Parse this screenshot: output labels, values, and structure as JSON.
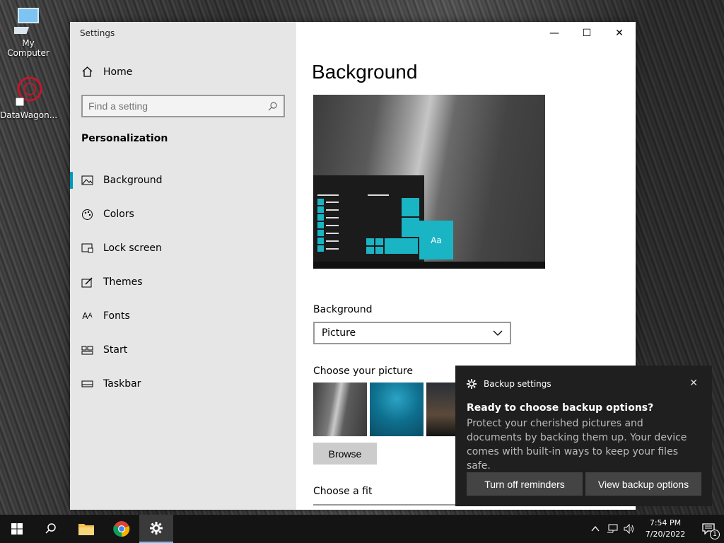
{
  "desktop": {
    "icons": [
      {
        "label": "My Computer",
        "icon": "computer-icon"
      },
      {
        "label": "DataWagon...",
        "icon": "app-shortcut-icon"
      }
    ]
  },
  "window": {
    "title": "Settings",
    "controls": {
      "minimize": "—",
      "maximize": "☐",
      "close": "✕"
    }
  },
  "sidebar": {
    "home_label": "Home",
    "search_placeholder": "Find a setting",
    "section_title": "Personalization",
    "items": [
      {
        "label": "Background",
        "icon": "image-icon",
        "active": true
      },
      {
        "label": "Colors",
        "icon": "palette-icon"
      },
      {
        "label": "Lock screen",
        "icon": "lock-screen-icon"
      },
      {
        "label": "Themes",
        "icon": "themes-icon"
      },
      {
        "label": "Fonts",
        "icon": "fonts-icon"
      },
      {
        "label": "Start",
        "icon": "start-icon"
      },
      {
        "label": "Taskbar",
        "icon": "taskbar-icon"
      }
    ]
  },
  "content": {
    "title": "Background",
    "preview_tile_text": "Aa",
    "background_label": "Background",
    "background_value": "Picture",
    "choose_picture_label": "Choose your picture",
    "browse_label": "Browse",
    "choose_fit_label": "Choose a fit"
  },
  "toast": {
    "app_name": "Backup settings",
    "title": "Ready to choose backup options?",
    "body": "Protect your cherished pictures and documents by backing them up. Your device comes with built-in ways to keep your files safe.",
    "button_left": "Turn off reminders",
    "button_right": "View backup options",
    "close": "✕"
  },
  "taskbar": {
    "time": "7:54 PM",
    "date": "7/20/2022",
    "notification_count": "1",
    "accent": "#76b9ed"
  },
  "colors": {
    "accent": "#0099bc",
    "tile": "#1ab5c4"
  }
}
